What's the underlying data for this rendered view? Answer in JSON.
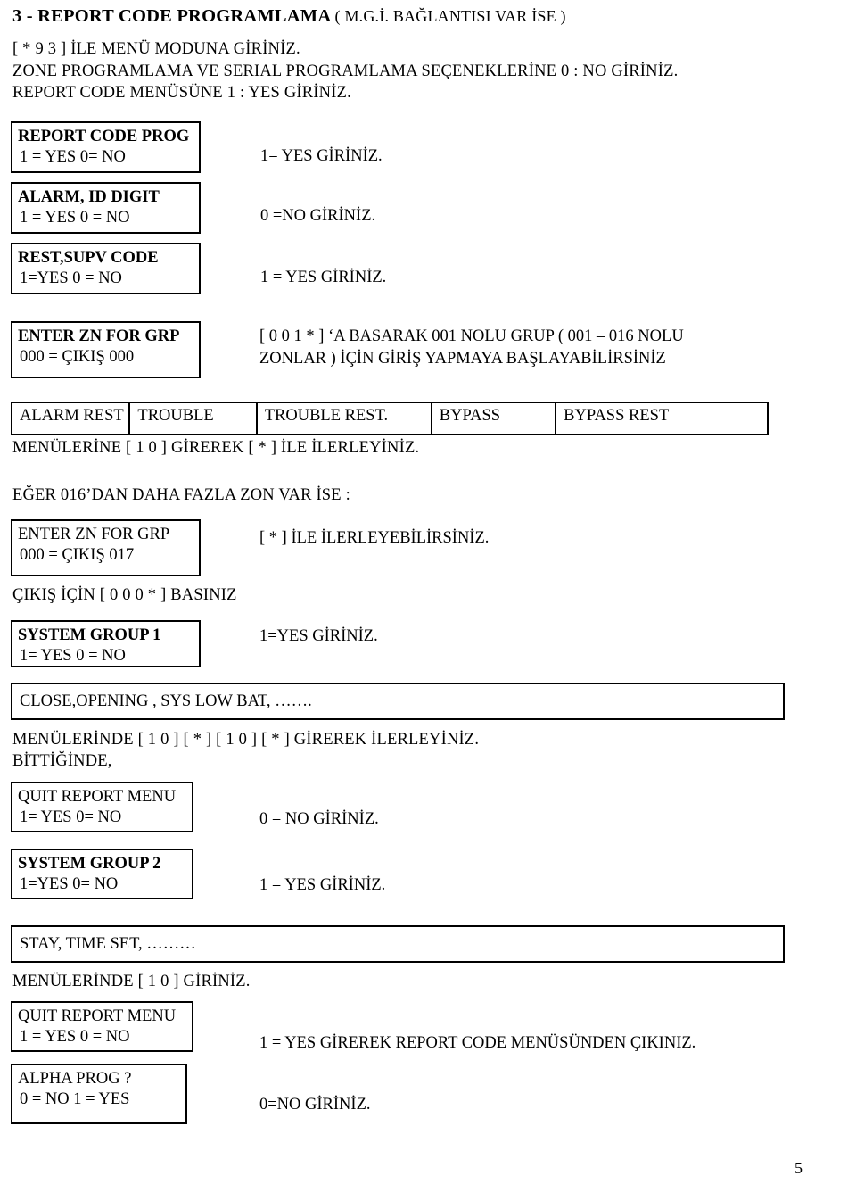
{
  "document": {
    "page_number": "5",
    "title_main": "3 - REPORT CODE PROGRAMLAMA",
    "title_sub": "( M.G.İ. BAĞLANTISI VAR İSE )"
  },
  "intro": {
    "line1": "[ * 9 3 ] İLE MENÜ MODUNA GİRİNİZ.",
    "line2": "ZONE PROGRAMLAMA VE SERIAL PROGRAMLAMA SEÇENEKLERİNE  0 : NO GİRİNİZ.",
    "line3": "REPORT CODE MENÜSÜNE  1 : YES GİRİNİZ."
  },
  "steps": [
    {
      "box_line1": "REPORT CODE PROG",
      "box_line2": "1 = YES  0= NO",
      "instruction": "1= YES GİRİNİZ."
    },
    {
      "box_line1": "ALARM, ID DIGIT",
      "box_line2": "1 = YES  0 = NO",
      "instruction": "0 =NO GİRİNİZ."
    },
    {
      "box_line1": "REST,SUPV CODE",
      "box_line2": "1=YES   0 = NO",
      "instruction": "1 = YES GİRİNİZ."
    }
  ],
  "zone_group": {
    "box_line1": "ENTER ZN FOR GRP",
    "box_line2": "000 = ÇIKIŞ      000",
    "instruction_line1": "[ 0 0 1 * ] ‘A BASARAK 001 NOLU GRUP ( 001 – 016 NOLU",
    "instruction_line2": "ZONLAR ) İÇİN GİRİŞ YAPMAYA BAŞLAYABİLİRSİNİZ"
  },
  "menu_table": {
    "columns": [
      "ALARM REST",
      "TROUBLE",
      "TROUBLE REST.",
      "BYPASS",
      "BYPASS REST"
    ]
  },
  "after_table": {
    "line1": "MENÜLERİNE   [ 1 0 ] GİREREK [ * ] İLE İLERLEYİNİZ.",
    "line2": "EĞER 016’DAN DAHA FAZLA ZON VAR İSE :"
  },
  "zone_group_017": {
    "box_line1": "ENTER ZN FOR GRP",
    "box_line2": "000 = ÇIKIŞ      017",
    "instruction": "[ * ] İLE İLERLEYEBİLİRSİNİZ.",
    "exit_note": "ÇIKIŞ İÇİN [ 0 0 0   * ] BASINIZ"
  },
  "system_group_1": {
    "box_line1": "SYSTEM GROUP 1",
    "box_line2": "1= YES   0 = NO",
    "instruction": "1=YES GİRİNİZ."
  },
  "wide_box_1": {
    "text": "CLOSE,OPENING , SYS LOW BAT, ……."
  },
  "after_wide_1": {
    "line1": "MENÜLERİNDE  [ 1 0  ]  [ * ]  [ 1 0 ]  [ * ]  GİREREK İLERLEYİNİZ.",
    "line2": "BİTTİĞİNDE,"
  },
  "quit_report_menu_1": {
    "box_line1": "QUIT REPORT MENU",
    "box_line2": "1= YES  0= NO",
    "instruction": "0 = NO  GİRİNİZ."
  },
  "system_group_2": {
    "box_line1": "SYSTEM GROUP 2",
    "box_line2": "1=YES  0= NO",
    "instruction": "1 = YES GİRİNİZ."
  },
  "wide_box_2": {
    "text": "STAY, TIME SET, ………"
  },
  "after_wide_2": {
    "line1": "MENÜLERİNDE  [ 1 0  ] GİRİNİZ."
  },
  "quit_report_menu_2": {
    "box_line1": "QUIT REPORT MENU",
    "box_line2": "1 = YES  0 = NO",
    "instruction": "1 = YES GİREREK REPORT CODE MENÜSÜNDEN ÇIKINIZ."
  },
  "alpha_prog": {
    "box_line1": "ALPHA PROG ?",
    "box_line2": "0 = NO  1 = YES",
    "instruction": "0=NO GİRİNİZ."
  }
}
